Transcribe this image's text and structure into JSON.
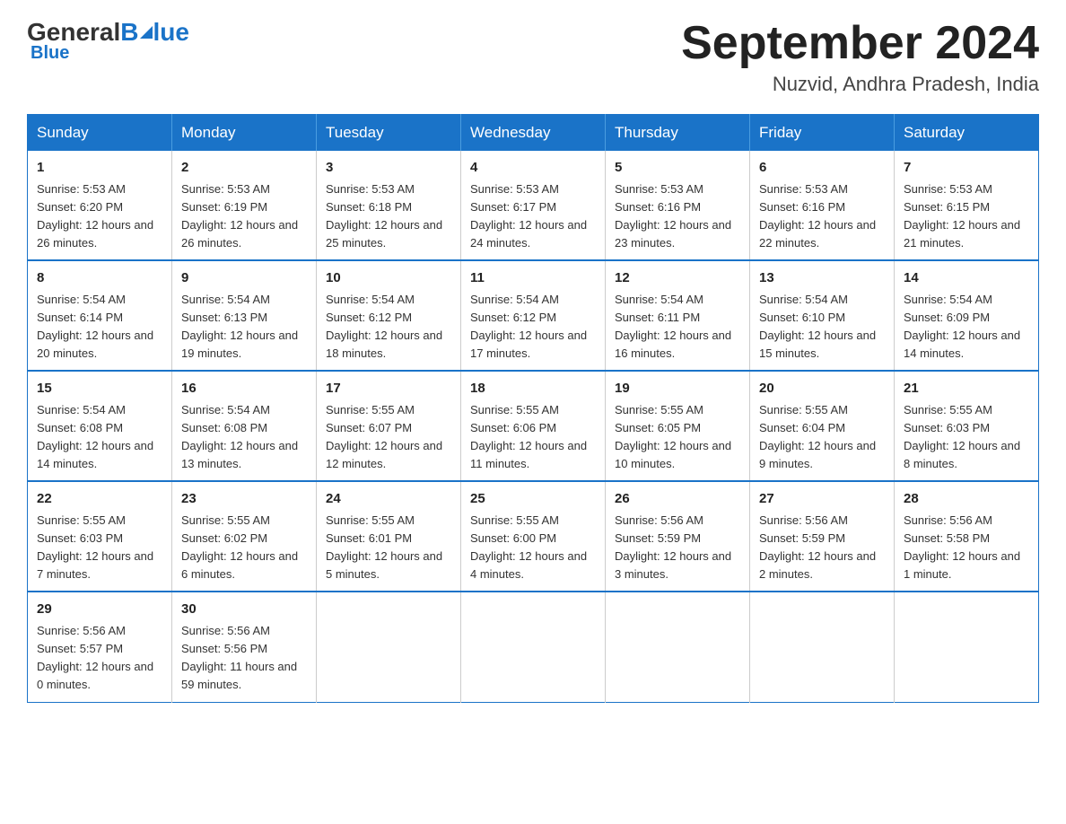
{
  "logo": {
    "general": "General",
    "blue": "Blue"
  },
  "header": {
    "month_year": "September 2024",
    "location": "Nuzvid, Andhra Pradesh, India"
  },
  "days_of_week": [
    "Sunday",
    "Monday",
    "Tuesday",
    "Wednesday",
    "Thursday",
    "Friday",
    "Saturday"
  ],
  "weeks": [
    [
      {
        "day": "1",
        "sunrise": "Sunrise: 5:53 AM",
        "sunset": "Sunset: 6:20 PM",
        "daylight": "Daylight: 12 hours and 26 minutes."
      },
      {
        "day": "2",
        "sunrise": "Sunrise: 5:53 AM",
        "sunset": "Sunset: 6:19 PM",
        "daylight": "Daylight: 12 hours and 26 minutes."
      },
      {
        "day": "3",
        "sunrise": "Sunrise: 5:53 AM",
        "sunset": "Sunset: 6:18 PM",
        "daylight": "Daylight: 12 hours and 25 minutes."
      },
      {
        "day": "4",
        "sunrise": "Sunrise: 5:53 AM",
        "sunset": "Sunset: 6:17 PM",
        "daylight": "Daylight: 12 hours and 24 minutes."
      },
      {
        "day": "5",
        "sunrise": "Sunrise: 5:53 AM",
        "sunset": "Sunset: 6:16 PM",
        "daylight": "Daylight: 12 hours and 23 minutes."
      },
      {
        "day": "6",
        "sunrise": "Sunrise: 5:53 AM",
        "sunset": "Sunset: 6:16 PM",
        "daylight": "Daylight: 12 hours and 22 minutes."
      },
      {
        "day": "7",
        "sunrise": "Sunrise: 5:53 AM",
        "sunset": "Sunset: 6:15 PM",
        "daylight": "Daylight: 12 hours and 21 minutes."
      }
    ],
    [
      {
        "day": "8",
        "sunrise": "Sunrise: 5:54 AM",
        "sunset": "Sunset: 6:14 PM",
        "daylight": "Daylight: 12 hours and 20 minutes."
      },
      {
        "day": "9",
        "sunrise": "Sunrise: 5:54 AM",
        "sunset": "Sunset: 6:13 PM",
        "daylight": "Daylight: 12 hours and 19 minutes."
      },
      {
        "day": "10",
        "sunrise": "Sunrise: 5:54 AM",
        "sunset": "Sunset: 6:12 PM",
        "daylight": "Daylight: 12 hours and 18 minutes."
      },
      {
        "day": "11",
        "sunrise": "Sunrise: 5:54 AM",
        "sunset": "Sunset: 6:12 PM",
        "daylight": "Daylight: 12 hours and 17 minutes."
      },
      {
        "day": "12",
        "sunrise": "Sunrise: 5:54 AM",
        "sunset": "Sunset: 6:11 PM",
        "daylight": "Daylight: 12 hours and 16 minutes."
      },
      {
        "day": "13",
        "sunrise": "Sunrise: 5:54 AM",
        "sunset": "Sunset: 6:10 PM",
        "daylight": "Daylight: 12 hours and 15 minutes."
      },
      {
        "day": "14",
        "sunrise": "Sunrise: 5:54 AM",
        "sunset": "Sunset: 6:09 PM",
        "daylight": "Daylight: 12 hours and 14 minutes."
      }
    ],
    [
      {
        "day": "15",
        "sunrise": "Sunrise: 5:54 AM",
        "sunset": "Sunset: 6:08 PM",
        "daylight": "Daylight: 12 hours and 14 minutes."
      },
      {
        "day": "16",
        "sunrise": "Sunrise: 5:54 AM",
        "sunset": "Sunset: 6:08 PM",
        "daylight": "Daylight: 12 hours and 13 minutes."
      },
      {
        "day": "17",
        "sunrise": "Sunrise: 5:55 AM",
        "sunset": "Sunset: 6:07 PM",
        "daylight": "Daylight: 12 hours and 12 minutes."
      },
      {
        "day": "18",
        "sunrise": "Sunrise: 5:55 AM",
        "sunset": "Sunset: 6:06 PM",
        "daylight": "Daylight: 12 hours and 11 minutes."
      },
      {
        "day": "19",
        "sunrise": "Sunrise: 5:55 AM",
        "sunset": "Sunset: 6:05 PM",
        "daylight": "Daylight: 12 hours and 10 minutes."
      },
      {
        "day": "20",
        "sunrise": "Sunrise: 5:55 AM",
        "sunset": "Sunset: 6:04 PM",
        "daylight": "Daylight: 12 hours and 9 minutes."
      },
      {
        "day": "21",
        "sunrise": "Sunrise: 5:55 AM",
        "sunset": "Sunset: 6:03 PM",
        "daylight": "Daylight: 12 hours and 8 minutes."
      }
    ],
    [
      {
        "day": "22",
        "sunrise": "Sunrise: 5:55 AM",
        "sunset": "Sunset: 6:03 PM",
        "daylight": "Daylight: 12 hours and 7 minutes."
      },
      {
        "day": "23",
        "sunrise": "Sunrise: 5:55 AM",
        "sunset": "Sunset: 6:02 PM",
        "daylight": "Daylight: 12 hours and 6 minutes."
      },
      {
        "day": "24",
        "sunrise": "Sunrise: 5:55 AM",
        "sunset": "Sunset: 6:01 PM",
        "daylight": "Daylight: 12 hours and 5 minutes."
      },
      {
        "day": "25",
        "sunrise": "Sunrise: 5:55 AM",
        "sunset": "Sunset: 6:00 PM",
        "daylight": "Daylight: 12 hours and 4 minutes."
      },
      {
        "day": "26",
        "sunrise": "Sunrise: 5:56 AM",
        "sunset": "Sunset: 5:59 PM",
        "daylight": "Daylight: 12 hours and 3 minutes."
      },
      {
        "day": "27",
        "sunrise": "Sunrise: 5:56 AM",
        "sunset": "Sunset: 5:59 PM",
        "daylight": "Daylight: 12 hours and 2 minutes."
      },
      {
        "day": "28",
        "sunrise": "Sunrise: 5:56 AM",
        "sunset": "Sunset: 5:58 PM",
        "daylight": "Daylight: 12 hours and 1 minute."
      }
    ],
    [
      {
        "day": "29",
        "sunrise": "Sunrise: 5:56 AM",
        "sunset": "Sunset: 5:57 PM",
        "daylight": "Daylight: 12 hours and 0 minutes."
      },
      {
        "day": "30",
        "sunrise": "Sunrise: 5:56 AM",
        "sunset": "Sunset: 5:56 PM",
        "daylight": "Daylight: 11 hours and 59 minutes."
      },
      null,
      null,
      null,
      null,
      null
    ]
  ]
}
